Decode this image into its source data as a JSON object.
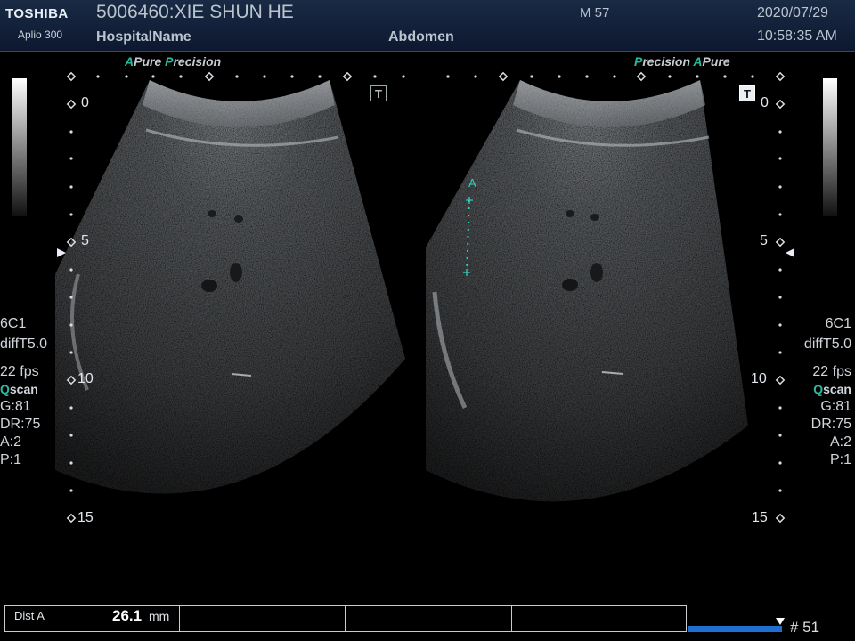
{
  "header": {
    "brand": "TOSHIBA",
    "model": "Aplio 300",
    "patient": "5006460:XIE SHUN HE",
    "hospital": "HospitalName",
    "exam": "Abdomen",
    "mindex": "M 57",
    "date": "2020/07/29",
    "time": "10:58:35 AM"
  },
  "left_panel": {
    "tag_a": "A",
    "tag_pure": "Pure",
    "tag_p": "P",
    "tag_recision": "recision",
    "t_icon": "T",
    "depth_marks": [
      "0",
      "5",
      "10",
      "15"
    ],
    "probe": "6C1",
    "mode": "diffT5.0",
    "fps": "22 fps",
    "q": "Q",
    "scan": "scan",
    "gain": "G:81",
    "dr": "DR:75",
    "a": "A:2",
    "p": "P:1"
  },
  "right_panel": {
    "tag_p": "P",
    "tag_recision": "recision",
    "tag_a": "A",
    "tag_pure": "Pure",
    "t_icon": "T",
    "depth_marks": [
      "0",
      "5",
      "10",
      "15"
    ],
    "probe": "6C1",
    "mode": "diffT5.0",
    "fps": "22 fps",
    "q": "Q",
    "scan": "scan",
    "gain": "G:81",
    "dr": "DR:75",
    "a": "A:2",
    "p": "P:1"
  },
  "caliper": {
    "label": "A"
  },
  "measurement": {
    "label": "Dist A",
    "value": "26.1",
    "unit": "mm"
  },
  "cine": {
    "frame": "# 51",
    "position": 1.0
  },
  "colors": {
    "accent": "#2bb8a0",
    "header": "#14213a",
    "cine": "#1e6fd0",
    "caliper": "#2bd0c0"
  }
}
